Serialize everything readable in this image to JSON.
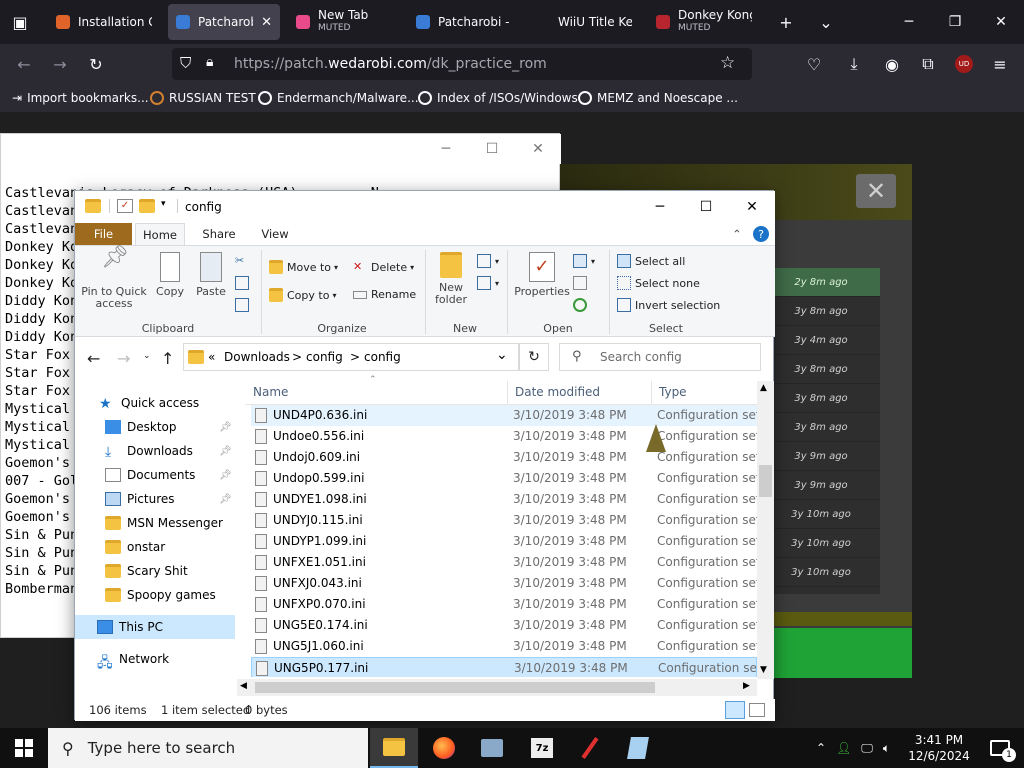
{
  "browser": {
    "tabs": [
      {
        "title": "Installation Gu",
        "sub": "",
        "color": "#e0632a"
      },
      {
        "title": "Patcharobi",
        "sub": "",
        "color": "#3a7bd5",
        "active": true
      },
      {
        "title": "New Tab",
        "sub": "MUTED",
        "color": "#e94b8a"
      },
      {
        "title": "Patcharobi - R",
        "sub": "",
        "color": "#3a7bd5"
      },
      {
        "title": "WiiU Title Key",
        "sub": "",
        "color": ""
      },
      {
        "title": "Donkey Kong",
        "sub": "MUTED",
        "color": "#b7262f"
      }
    ],
    "close_symbol": "✕",
    "url_prefix": "https://patch.",
    "url_domain": "wedarobi.com",
    "url_path": "/dk_practice_rom",
    "bookmarks": [
      "Import bookmarks...",
      "RUSSIAN TEST",
      "Endermanch/Malware...",
      "Index of /ISOs/Windows",
      "MEMZ and Noescape ..."
    ],
    "extension_badge": "UD"
  },
  "page": {
    "times": [
      "2y 8m ago",
      "3y 8m ago",
      "3y 4m ago",
      "3y 8m ago",
      "3y 8m ago",
      "3y 8m ago",
      "3y 9m ago",
      "3y 9m ago",
      "3y 10m ago",
      "3y 10m ago",
      "3y 10m ago"
    ],
    "close_symbol": "✕"
  },
  "notepad": {
    "lines": [
      "Castlevania Legacy of Darkness (USA)         N",
      "Castlevan",
      "Castlevan",
      "Donkey Ko",
      "Donkey Ko",
      "Donkey Ko",
      "Diddy Kon",
      "Diddy Kon",
      "Diddy Kon",
      "Star Fox",
      "Star Fox",
      "Star Fox",
      "Mystical",
      "Mystical",
      "Mystical",
      "Goemon's",
      "007 - Gol",
      "Goemon's",
      "Goemon's",
      "Sin & Pun",
      "Sin & Pun",
      "Sin & Pun",
      "Bomberman"
    ]
  },
  "explorer": {
    "title": "config",
    "ribbon_tabs": [
      "File",
      "Home",
      "Share",
      "View"
    ],
    "clipboard": {
      "pin": "Pin to Quick access",
      "copy": "Copy",
      "paste": "Paste",
      "label": "Clipboard"
    },
    "organize": {
      "move_to": "Move to",
      "copy_to": "Copy to",
      "delete": "Delete",
      "rename": "Rename",
      "label": "Organize"
    },
    "new": {
      "new_folder": "New folder",
      "label": "New"
    },
    "open": {
      "properties": "Properties",
      "label": "Open"
    },
    "select": {
      "all": "Select all",
      "none": "Select none",
      "invert": "Invert selection",
      "label": "Select"
    },
    "breadcrumb": [
      "«",
      "Downloads",
      ">",
      "config",
      ">",
      "config"
    ],
    "search_placeholder": "Search config",
    "columns": {
      "name": "Name",
      "date": "Date modified",
      "type": "Type"
    },
    "nav": [
      {
        "label": "Quick access",
        "icon": "star",
        "pin": false
      },
      {
        "label": "Desktop",
        "icon": "desktop",
        "pin": true
      },
      {
        "label": "Downloads",
        "icon": "download",
        "pin": true
      },
      {
        "label": "Documents",
        "icon": "document",
        "pin": true
      },
      {
        "label": "Pictures",
        "icon": "picture",
        "pin": true
      },
      {
        "label": "MSN Messenger",
        "icon": "folder",
        "pin": false
      },
      {
        "label": "onstar",
        "icon": "folder",
        "pin": false
      },
      {
        "label": "Scary Shit",
        "icon": "folder",
        "pin": false
      },
      {
        "label": "Spoopy games",
        "icon": "folder",
        "pin": false
      },
      {
        "label": "This PC",
        "icon": "pc",
        "pin": false
      },
      {
        "label": "Network",
        "icon": "network",
        "pin": false
      }
    ],
    "files": [
      {
        "name": "UND4P0.636.ini",
        "date": "3/10/2019 3:48 PM",
        "type": "Configuration sett..."
      },
      {
        "name": "Undoe0.556.ini",
        "date": "3/10/2019 3:48 PM",
        "type": "Configuration sett..."
      },
      {
        "name": "Undoj0.609.ini",
        "date": "3/10/2019 3:48 PM",
        "type": "Configuration sett..."
      },
      {
        "name": "Undop0.599.ini",
        "date": "3/10/2019 3:48 PM",
        "type": "Configuration sett..."
      },
      {
        "name": "UNDYE1.098.ini",
        "date": "3/10/2019 3:48 PM",
        "type": "Configuration sett..."
      },
      {
        "name": "UNDYJ0.115.ini",
        "date": "3/10/2019 3:48 PM",
        "type": "Configuration sett..."
      },
      {
        "name": "UNDYP1.099.ini",
        "date": "3/10/2019 3:48 PM",
        "type": "Configuration sett..."
      },
      {
        "name": "UNFXE1.051.ini",
        "date": "3/10/2019 3:48 PM",
        "type": "Configuration sett..."
      },
      {
        "name": "UNFXJ0.043.ini",
        "date": "3/10/2019 3:48 PM",
        "type": "Configuration sett..."
      },
      {
        "name": "UNFXP0.070.ini",
        "date": "3/10/2019 3:48 PM",
        "type": "Configuration sett..."
      },
      {
        "name": "UNG5E0.174.ini",
        "date": "3/10/2019 3:48 PM",
        "type": "Configuration sett..."
      },
      {
        "name": "UNG5J1.060.ini",
        "date": "3/10/2019 3:48 PM",
        "type": "Configuration sett..."
      },
      {
        "name": "UNG5P0.177.ini",
        "date": "3/10/2019 3:48 PM",
        "type": "Configuration sett..."
      }
    ],
    "selected_row": 12,
    "hover_row": 0,
    "status": {
      "count": "106 items",
      "selected": "1 item selected",
      "size": "0 bytes"
    }
  },
  "taskbar": {
    "search_placeholder": "Type here to search",
    "time": "3:41 PM",
    "date": "12/6/2024",
    "notifications": "1"
  }
}
